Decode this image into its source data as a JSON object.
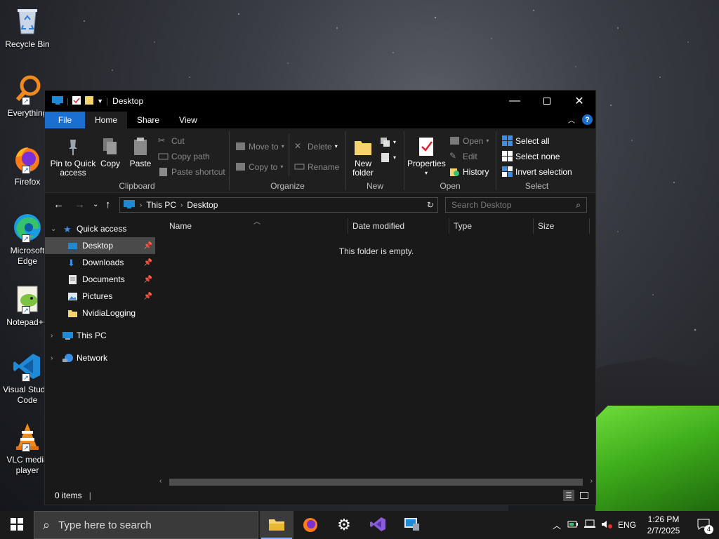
{
  "desktop": {
    "icons": [
      {
        "label": "Recycle Bin"
      },
      {
        "label": "Everything"
      },
      {
        "label": "Firefox"
      },
      {
        "label": "Microsoft Edge"
      },
      {
        "label": "Notepad++"
      },
      {
        "label": "Visual Studio Code"
      },
      {
        "label": "VLC media player"
      }
    ]
  },
  "window": {
    "title": "Desktop",
    "tabs": {
      "file": "File",
      "home": "Home",
      "share": "Share",
      "view": "View"
    },
    "help": "?",
    "ribbon": {
      "clipboard": {
        "label": "Clipboard",
        "pin": "Pin to Quick access",
        "copy": "Copy",
        "paste": "Paste",
        "cut": "Cut",
        "copy_path": "Copy path",
        "paste_shortcut": "Paste shortcut"
      },
      "organize": {
        "label": "Organize",
        "move_to": "Move to",
        "copy_to": "Copy to",
        "delete": "Delete",
        "rename": "Rename"
      },
      "new": {
        "label": "New",
        "new_folder": "New folder"
      },
      "open": {
        "label": "Open",
        "properties": "Properties",
        "open": "Open",
        "edit": "Edit",
        "history": "History"
      },
      "select": {
        "label": "Select",
        "select_all": "Select all",
        "select_none": "Select none",
        "invert": "Invert selection"
      }
    },
    "address": {
      "segments": [
        "This PC",
        "Desktop"
      ],
      "search_placeholder": "Search Desktop"
    },
    "nav": {
      "quick_access": "Quick access",
      "items": [
        {
          "label": "Desktop",
          "pinned": true
        },
        {
          "label": "Downloads",
          "pinned": true
        },
        {
          "label": "Documents",
          "pinned": true
        },
        {
          "label": "Pictures",
          "pinned": true
        },
        {
          "label": "NvidiaLogging",
          "pinned": false
        }
      ],
      "this_pc": "This PC",
      "network": "Network"
    },
    "columns": [
      "Name",
      "Date modified",
      "Type",
      "Size"
    ],
    "empty_text": "This folder is empty.",
    "status": "0 items"
  },
  "taskbar": {
    "search_placeholder": "Type here to search",
    "language": "ENG",
    "time": "1:26 PM",
    "date": "2/7/2025",
    "notifications": "4"
  },
  "colors": {
    "accent": "#1a6fd0",
    "window_bg": "#191919",
    "ribbon_bg": "#1f1f1f",
    "selected": "#4a4a4a"
  }
}
